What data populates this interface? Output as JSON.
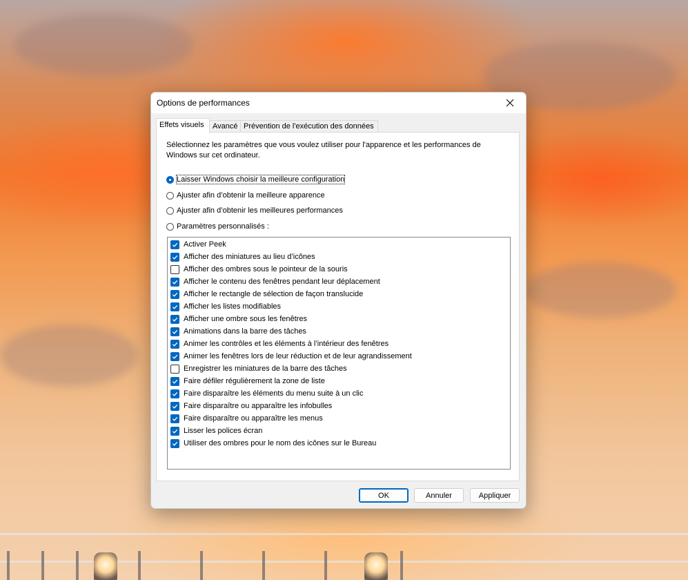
{
  "dialog": {
    "title": "Options de performances",
    "tabs": [
      {
        "label": "Effets visuels",
        "active": true
      },
      {
        "label": "Avancé",
        "active": false
      },
      {
        "label": "Prévention de l'exécution des données",
        "active": false
      }
    ],
    "intro": "Sélectionnez les paramètres que vous voulez utiliser pour l'apparence et les performances de Windows sur cet ordinateur.",
    "radios": [
      {
        "label": "Laisser Windows choisir la meilleure configuration",
        "checked": true
      },
      {
        "label": "Ajuster afin d’obtenir la meilleure apparence",
        "checked": false
      },
      {
        "label": "Ajuster afin d’obtenir les meilleures performances",
        "checked": false
      },
      {
        "label": "Paramètres personnalisés :",
        "checked": false
      }
    ],
    "options": [
      {
        "label": "Activer Peek",
        "checked": true
      },
      {
        "label": "Afficher des miniatures au lieu d’icônes",
        "checked": true
      },
      {
        "label": "Afficher des ombres sous le pointeur de la souris",
        "checked": false
      },
      {
        "label": "Afficher le contenu des fenêtres pendant leur déplacement",
        "checked": true
      },
      {
        "label": "Afficher le rectangle de sélection de façon translucide",
        "checked": true
      },
      {
        "label": "Afficher les listes modifiables",
        "checked": true
      },
      {
        "label": "Afficher une ombre sous les fenêtres",
        "checked": true
      },
      {
        "label": "Animations dans la barre des tâches",
        "checked": true
      },
      {
        "label": "Animer les contrôles et les éléments à l’intérieur des fenêtres",
        "checked": true
      },
      {
        "label": "Animer les fenêtres lors de leur réduction et de leur agrandissement",
        "checked": true
      },
      {
        "label": "Enregistrer les miniatures de la barre des tâches",
        "checked": false
      },
      {
        "label": "Faire défiler régulièrement la zone de liste",
        "checked": true
      },
      {
        "label": "Faire disparaître les éléments du menu suite à un clic",
        "checked": true
      },
      {
        "label": "Faire disparaître ou apparaître les infobulles",
        "checked": true
      },
      {
        "label": "Faire disparaître ou apparaître les menus",
        "checked": true
      },
      {
        "label": "Lisser les polices écran",
        "checked": true
      },
      {
        "label": "Utiliser des ombres pour le nom des icônes sur le Bureau",
        "checked": true
      }
    ],
    "buttons": {
      "ok": "OK",
      "cancel": "Annuler",
      "apply": "Appliquer"
    }
  },
  "colors": {
    "accent": "#0067c0"
  },
  "icons": {
    "close": "close-icon",
    "check": "checkmark-icon"
  }
}
